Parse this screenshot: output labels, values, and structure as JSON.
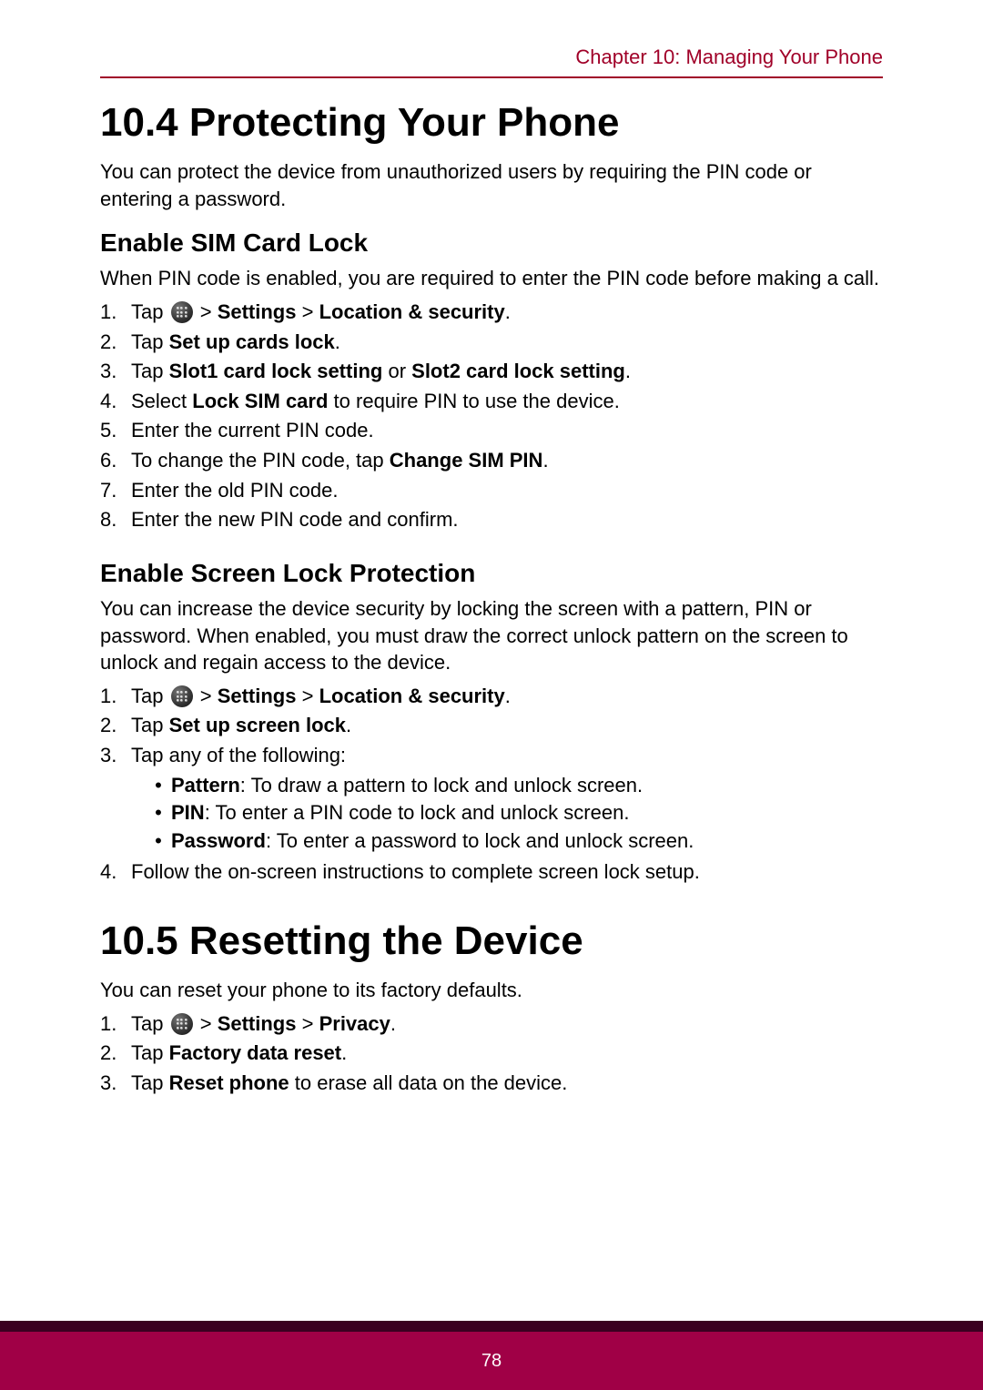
{
  "header": {
    "chapter": "Chapter 10: Managing Your Phone"
  },
  "section104": {
    "title": "10.4 Protecting Your Phone",
    "intro": "You can protect the device from unauthorized users by requiring the PIN code or entering a password.",
    "sim": {
      "heading": "Enable SIM Card Lock",
      "intro": "When PIN code is enabled, you are required to enter the PIN code before making a call.",
      "steps": {
        "s1_tap": "Tap ",
        "s1_gt1": " > ",
        "s1_settings": "Settings",
        "s1_gt2": " > ",
        "s1_loc": "Location & security",
        "s1_dot": ".",
        "s2_tap": "Tap ",
        "s2_bold": "Set up cards lock",
        "s2_dot": ".",
        "s3_tap": "Tap ",
        "s3_b1": "Slot1 card lock setting",
        "s3_or": " or ",
        "s3_b2": "Slot2 card lock setting",
        "s3_dot": ".",
        "s4_sel": "Select ",
        "s4_bold": "Lock SIM card",
        "s4_rest": " to require PIN to use the device.",
        "s5": "Enter the current PIN code.",
        "s6_a": "To change the PIN code, tap ",
        "s6_bold": "Change SIM PIN",
        "s6_dot": ".",
        "s7": "Enter the old PIN code.",
        "s8": "Enter the new PIN code and confirm."
      }
    },
    "screen": {
      "heading": "Enable Screen Lock Protection",
      "intro": "You can increase the device security by locking the screen with a pattern, PIN or password. When enabled, you must draw the correct unlock pattern on the screen to unlock and regain access to the device.",
      "steps": {
        "s1_tap": "Tap ",
        "s1_gt1": " > ",
        "s1_settings": "Settings",
        "s1_gt2": " > ",
        "s1_loc": "Location & security",
        "s1_dot": ".",
        "s2_tap": "Tap ",
        "s2_bold": "Set up screen lock",
        "s2_dot": ".",
        "s3": "Tap any of the following:",
        "b1_bold": "Pattern",
        "b1_rest": ": To draw a pattern to lock and unlock screen.",
        "b2_bold": "PIN",
        "b2_rest": ": To enter a PIN code to lock and unlock screen.",
        "b3_bold": "Password",
        "b3_rest": ": To enter a password to lock and unlock screen.",
        "s4": "Follow the on-screen instructions to complete screen lock setup."
      }
    }
  },
  "section105": {
    "title": "10.5 Resetting the Device",
    "intro": "You can reset your phone to its factory defaults.",
    "steps": {
      "s1_tap": "Tap ",
      "s1_gt1": " > ",
      "s1_settings": "Settings",
      "s1_gt2": " > ",
      "s1_priv": "Privacy",
      "s1_dot": ".",
      "s2_tap": "Tap ",
      "s2_bold": "Factory data reset",
      "s2_dot": ".",
      "s3_tap": "Tap ",
      "s3_bold": "Reset phone",
      "s3_rest": " to erase all data on the device."
    }
  },
  "footer": {
    "page": "78"
  },
  "nums": {
    "n1": "1.",
    "n2": "2.",
    "n3": "3.",
    "n4": "4.",
    "n5": "5.",
    "n6": "6.",
    "n7": "7.",
    "n8": "8."
  },
  "bullet": "•"
}
